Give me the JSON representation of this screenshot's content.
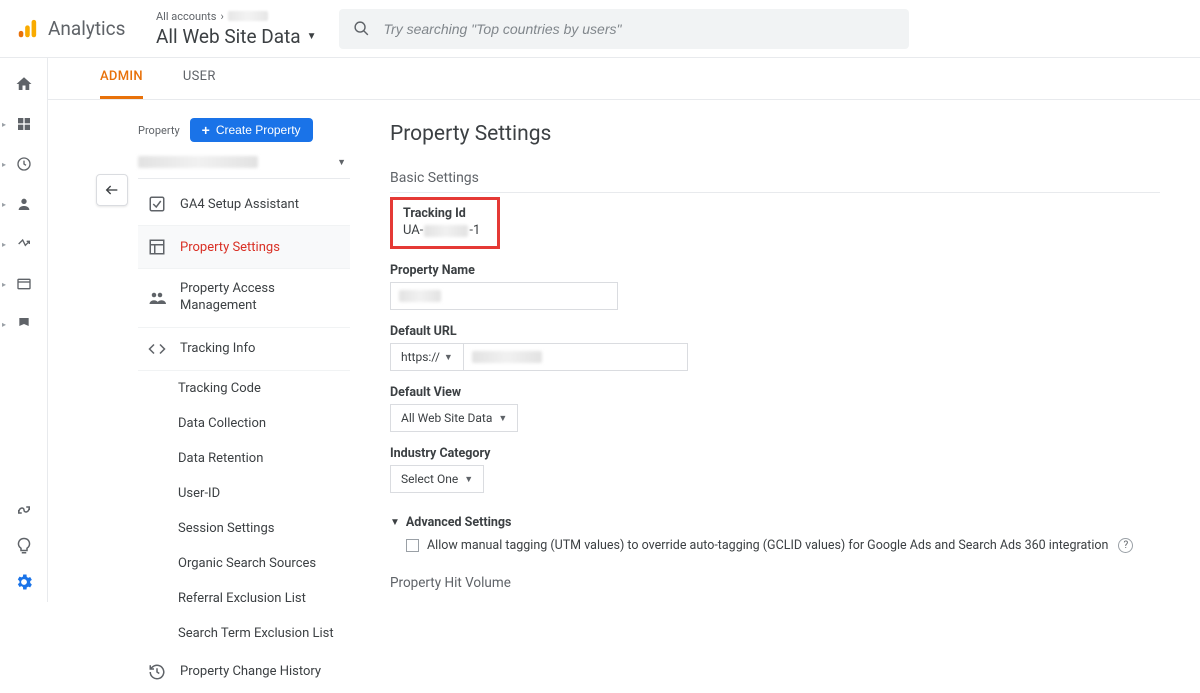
{
  "header": {
    "product_name": "Analytics",
    "breadcrumb_prefix": "All accounts",
    "title": "All Web Site Data",
    "search_placeholder": "Try searching \"Top countries by users\""
  },
  "tabs": {
    "admin": "ADMIN",
    "user": "USER"
  },
  "property": {
    "label": "Property",
    "create_btn": "Create Property",
    "nav": {
      "ga4": "GA4 Setup Assistant",
      "settings": "Property Settings",
      "access": "Property Access Management",
      "tracking": "Tracking Info",
      "tracking_sub": {
        "code": "Tracking Code",
        "collection": "Data Collection",
        "retention": "Data Retention",
        "userid": "User-ID",
        "session": "Session Settings",
        "organic": "Organic Search Sources",
        "referral": "Referral Exclusion List",
        "searchterm": "Search Term Exclusion List"
      },
      "history": "Property Change History"
    }
  },
  "settings": {
    "page_title": "Property Settings",
    "basic": "Basic Settings",
    "tracking_id_label": "Tracking Id",
    "tracking_id_prefix": "UA-",
    "tracking_id_suffix": "-1",
    "property_name_label": "Property Name",
    "default_url_label": "Default URL",
    "protocol": "https://",
    "default_view_label": "Default View",
    "default_view_value": "All Web Site Data",
    "industry_label": "Industry Category",
    "industry_value": "Select One",
    "advanced_label": "Advanced Settings",
    "manual_tagging": "Allow manual tagging (UTM values) to override auto-tagging (GCLID values) for Google Ads and Search Ads 360 integration",
    "hit_volume": "Property Hit Volume"
  }
}
